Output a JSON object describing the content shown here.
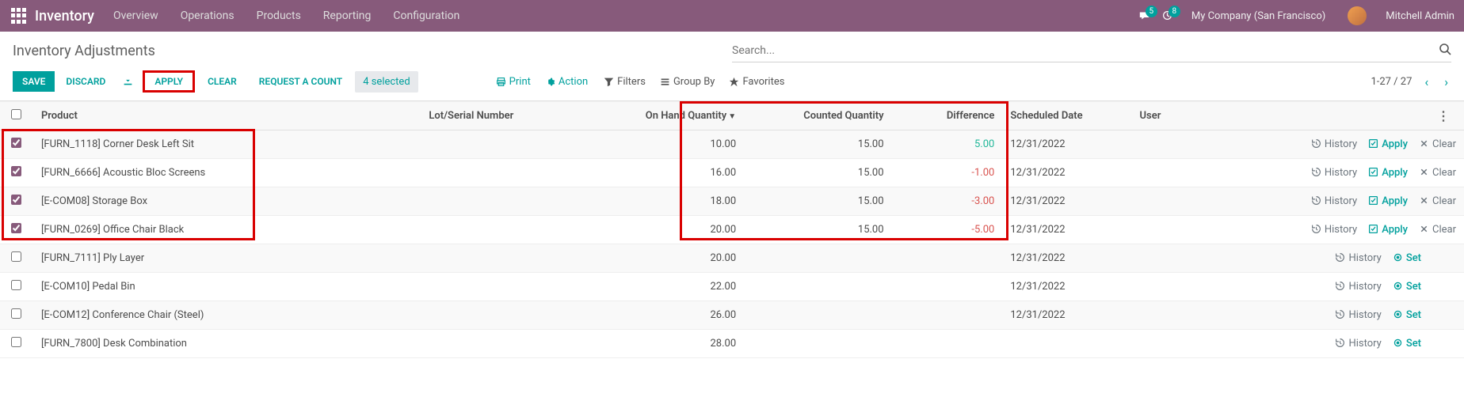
{
  "navbar": {
    "brand": "Inventory",
    "links": [
      "Overview",
      "Operations",
      "Products",
      "Reporting",
      "Configuration"
    ],
    "msg_badge": "5",
    "clock_badge": "8",
    "company": "My Company (San Francisco)",
    "username": "Mitchell Admin"
  },
  "breadcrumb": {
    "title": "Inventory Adjustments"
  },
  "search": {
    "placeholder": "Search..."
  },
  "toolbar": {
    "save": "SAVE",
    "discard": "DISCARD",
    "apply": "APPLY",
    "clear": "CLEAR",
    "request": "REQUEST A COUNT",
    "selected": "4 selected",
    "print": "Print",
    "action": "Action",
    "filters": "Filters",
    "groupby": "Group By",
    "favorites": "Favorites",
    "pager": "1-27 / 27"
  },
  "columns": {
    "product": "Product",
    "lot": "Lot/Serial Number",
    "onhand": "On Hand Quantity",
    "counted": "Counted Quantity",
    "diff": "Difference",
    "scheduled": "Scheduled Date",
    "user": "User"
  },
  "actions": {
    "history": "History",
    "apply": "Apply",
    "set": "Set",
    "clear": "Clear"
  },
  "rows": [
    {
      "checked": true,
      "product": "[FURN_1118] Corner Desk Left Sit",
      "lot": "",
      "onhand": "10.00",
      "counted": "15.00",
      "diff": "5.00",
      "diff_sign": "pos",
      "scheduled": "12/31/2022",
      "user": "",
      "has_apply": true
    },
    {
      "checked": true,
      "product": "[FURN_6666] Acoustic Bloc Screens",
      "lot": "",
      "onhand": "16.00",
      "counted": "15.00",
      "diff": "-1.00",
      "diff_sign": "neg",
      "scheduled": "12/31/2022",
      "user": "",
      "has_apply": true
    },
    {
      "checked": true,
      "product": "[E-COM08] Storage Box",
      "lot": "",
      "onhand": "18.00",
      "counted": "15.00",
      "diff": "-3.00",
      "diff_sign": "neg",
      "scheduled": "12/31/2022",
      "user": "",
      "has_apply": true
    },
    {
      "checked": true,
      "product": "[FURN_0269] Office Chair Black",
      "lot": "",
      "onhand": "20.00",
      "counted": "15.00",
      "diff": "-5.00",
      "diff_sign": "neg",
      "scheduled": "12/31/2022",
      "user": "",
      "has_apply": true
    },
    {
      "checked": false,
      "product": "[FURN_7111] Ply Layer",
      "lot": "",
      "onhand": "20.00",
      "counted": "",
      "diff": "",
      "diff_sign": "",
      "scheduled": "12/31/2022",
      "user": "",
      "has_apply": false
    },
    {
      "checked": false,
      "product": "[E-COM10] Pedal Bin",
      "lot": "",
      "onhand": "22.00",
      "counted": "",
      "diff": "",
      "diff_sign": "",
      "scheduled": "12/31/2022",
      "user": "",
      "has_apply": false
    },
    {
      "checked": false,
      "product": "[E-COM12] Conference Chair (Steel)",
      "lot": "",
      "onhand": "26.00",
      "counted": "",
      "diff": "",
      "diff_sign": "",
      "scheduled": "12/31/2022",
      "user": "",
      "has_apply": false
    },
    {
      "checked": false,
      "product": "[FURN_7800] Desk Combination",
      "lot": "",
      "onhand": "28.00",
      "counted": "",
      "diff": "",
      "diff_sign": "",
      "scheduled": "",
      "user": "",
      "has_apply": false
    }
  ]
}
